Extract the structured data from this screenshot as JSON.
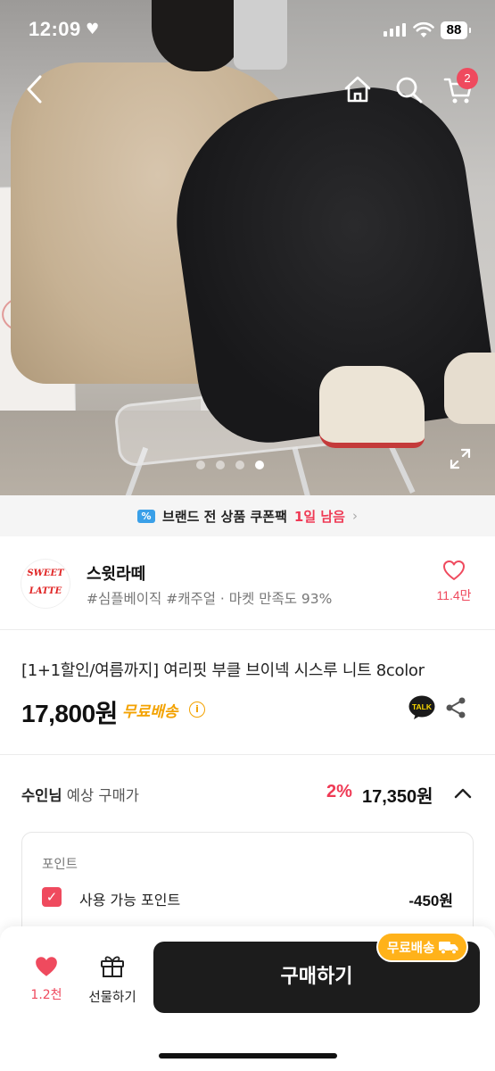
{
  "status_bar": {
    "time": "12:09",
    "battery": "88"
  },
  "nav": {
    "cart_count": "2"
  },
  "carousel": {
    "total": 4,
    "current": 4
  },
  "coupon": {
    "text": "브랜드 전 상품 쿠폰팩",
    "remaining": "1일 남음"
  },
  "brand": {
    "logo_text_1": "SWEET",
    "logo_text_2": "LATTE",
    "name": "스윗라떼",
    "tags": "#심플베이직 #캐주얼 · 마켓 만족도 93%",
    "likes": "11.4만"
  },
  "product": {
    "title": "[1+1할인/여름까지] 여리핏 부클 브이넥 시스루 니트 8color",
    "price": "17,800원",
    "shipping": "무료배송"
  },
  "expected": {
    "user": "수인님",
    "label": "예상 구매가",
    "rate": "2%",
    "price": "17,350원"
  },
  "points": {
    "header": "포인트",
    "label": "사용 가능 포인트",
    "value": "-450원",
    "checked": true
  },
  "bottom_bar": {
    "wish_count": "1.2천",
    "gift_label": "선물하기",
    "buy_label": "구매하기",
    "badge_label": "무료배송"
  },
  "colors": {
    "accent": "#ef4a5e",
    "shipping": "#f3a200",
    "buy_button": "#1c1c1c",
    "badge": "#ffb21a"
  }
}
